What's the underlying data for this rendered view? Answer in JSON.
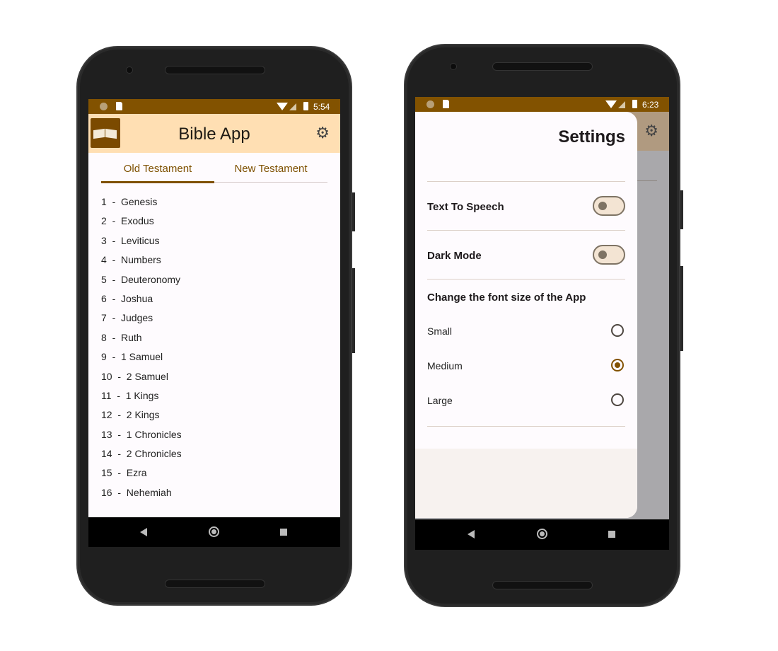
{
  "left_phone": {
    "status_time": "5:54",
    "app_title": "Bible App",
    "settings_icon": "gear-icon",
    "tabs": [
      {
        "label": "Old Testament",
        "active": true
      },
      {
        "label": "New Testament",
        "active": false
      }
    ],
    "books": [
      "1  -  Genesis",
      "2  -  Exodus",
      "3  -  Leviticus",
      "4  -  Numbers",
      "5  -  Deuteronomy",
      "6  -  Joshua",
      "7  -  Judges",
      "8  -  Ruth",
      "9  -  1 Samuel",
      "10  -  2 Samuel",
      "11  -  1 Kings",
      "12  -  2 Kings",
      "13  -  1 Chronicles",
      "14  -  2 Chronicles",
      "15  -  Ezra",
      "16  -  Nehemiah"
    ]
  },
  "right_phone": {
    "status_time": "6:23",
    "settings_title": "Settings",
    "text_to_speech": {
      "label": "Text To Speech",
      "on": false
    },
    "dark_mode": {
      "label": "Dark Mode",
      "on": false
    },
    "font_size_heading": "Change the font size of the App",
    "font_options": [
      {
        "label": "Small",
        "selected": false
      },
      {
        "label": "Medium",
        "selected": true
      },
      {
        "label": "Large",
        "selected": false
      }
    ]
  },
  "colors": {
    "status_bar": "#825200",
    "app_bar": "#ffdfb3",
    "accent": "#7e5000"
  }
}
